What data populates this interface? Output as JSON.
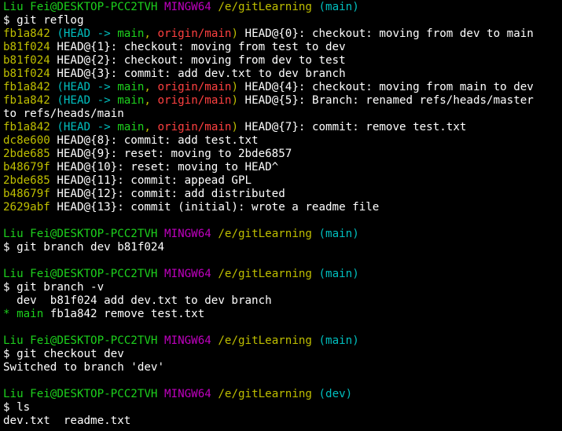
{
  "colors": {
    "default": "#ffffff",
    "green": "#1dd11d",
    "yellow": "#bfbf00",
    "magenta": "#bf00bf",
    "cyan": "#00bfbf",
    "red": "#ff4040",
    "bright_cyan": "#00d2d2"
  },
  "lines": [
    [
      {
        "t": "Liu Fei@DESKTOP-PCC2TVH",
        "c": "green"
      },
      {
        "t": " "
      },
      {
        "t": "MINGW64",
        "c": "magenta"
      },
      {
        "t": " "
      },
      {
        "t": "/e/gitLearning",
        "c": "yellow"
      },
      {
        "t": " "
      },
      {
        "t": "(main)",
        "c": "cyan"
      }
    ],
    [
      {
        "t": "$ git reflog"
      }
    ],
    [
      {
        "t": "fb1a842",
        "c": "yellow"
      },
      {
        "t": " "
      },
      {
        "t": "(HEAD -> ",
        "c": "cyan"
      },
      {
        "t": "main",
        "c": "green"
      },
      {
        "t": ", ",
        "c": "yellow"
      },
      {
        "t": "origin/main",
        "c": "red"
      },
      {
        "t": ")",
        "c": "yellow"
      },
      {
        "t": " HEAD@{0}: checkout: moving from dev to main"
      }
    ],
    [
      {
        "t": "b81f024",
        "c": "yellow"
      },
      {
        "t": " HEAD@{1}: checkout: moving from test to dev"
      }
    ],
    [
      {
        "t": "b81f024",
        "c": "yellow"
      },
      {
        "t": " HEAD@{2}: checkout: moving from dev to test"
      }
    ],
    [
      {
        "t": "b81f024",
        "c": "yellow"
      },
      {
        "t": " HEAD@{3}: commit: add dev.txt to dev branch"
      }
    ],
    [
      {
        "t": "fb1a842",
        "c": "yellow"
      },
      {
        "t": " "
      },
      {
        "t": "(HEAD -> ",
        "c": "cyan"
      },
      {
        "t": "main",
        "c": "green"
      },
      {
        "t": ", ",
        "c": "yellow"
      },
      {
        "t": "origin/main",
        "c": "red"
      },
      {
        "t": ")",
        "c": "yellow"
      },
      {
        "t": " HEAD@{4}: checkout: moving from main to dev"
      }
    ],
    [
      {
        "t": "fb1a842",
        "c": "yellow"
      },
      {
        "t": " "
      },
      {
        "t": "(HEAD -> ",
        "c": "cyan"
      },
      {
        "t": "main",
        "c": "green"
      },
      {
        "t": ", ",
        "c": "yellow"
      },
      {
        "t": "origin/main",
        "c": "red"
      },
      {
        "t": ")",
        "c": "yellow"
      },
      {
        "t": " HEAD@{5}: Branch: renamed refs/heads/master"
      }
    ],
    [
      {
        "t": "to refs/heads/main"
      }
    ],
    [
      {
        "t": "fb1a842",
        "c": "yellow"
      },
      {
        "t": " "
      },
      {
        "t": "(HEAD -> ",
        "c": "cyan"
      },
      {
        "t": "main",
        "c": "green"
      },
      {
        "t": ", ",
        "c": "yellow"
      },
      {
        "t": "origin/main",
        "c": "red"
      },
      {
        "t": ")",
        "c": "yellow"
      },
      {
        "t": " HEAD@{7}: commit: remove test.txt"
      }
    ],
    [
      {
        "t": "dc8e600",
        "c": "yellow"
      },
      {
        "t": " HEAD@{8}: commit: add test.txt"
      }
    ],
    [
      {
        "t": "2bde685",
        "c": "yellow"
      },
      {
        "t": " HEAD@{9}: reset: moving to 2bde6857"
      }
    ],
    [
      {
        "t": "b48679f",
        "c": "yellow"
      },
      {
        "t": " HEAD@{10}: reset: moving to HEAD^"
      }
    ],
    [
      {
        "t": "2bde685",
        "c": "yellow"
      },
      {
        "t": " HEAD@{11}: commit: appead GPL"
      }
    ],
    [
      {
        "t": "b48679f",
        "c": "yellow"
      },
      {
        "t": " HEAD@{12}: commit: add distributed"
      }
    ],
    [
      {
        "t": "2629abf",
        "c": "yellow"
      },
      {
        "t": " HEAD@{13}: commit (initial): wrote a readme file"
      }
    ],
    [],
    [
      {
        "t": "Liu Fei@DESKTOP-PCC2TVH",
        "c": "green"
      },
      {
        "t": " "
      },
      {
        "t": "MINGW64",
        "c": "magenta"
      },
      {
        "t": " "
      },
      {
        "t": "/e/gitLearning",
        "c": "yellow"
      },
      {
        "t": " "
      },
      {
        "t": "(main)",
        "c": "cyan"
      }
    ],
    [
      {
        "t": "$ git branch dev b81f024"
      }
    ],
    [],
    [
      {
        "t": "Liu Fei@DESKTOP-PCC2TVH",
        "c": "green"
      },
      {
        "t": " "
      },
      {
        "t": "MINGW64",
        "c": "magenta"
      },
      {
        "t": " "
      },
      {
        "t": "/e/gitLearning",
        "c": "yellow"
      },
      {
        "t": " "
      },
      {
        "t": "(main)",
        "c": "cyan"
      }
    ],
    [
      {
        "t": "$ git branch -v"
      }
    ],
    [
      {
        "t": "  dev  b81f024 add dev.txt to dev branch"
      }
    ],
    [
      {
        "t": "* ",
        "c": "green"
      },
      {
        "t": "main",
        "c": "green"
      },
      {
        "t": " fb1a842 remove test.txt"
      }
    ],
    [],
    [
      {
        "t": "Liu Fei@DESKTOP-PCC2TVH",
        "c": "green"
      },
      {
        "t": " "
      },
      {
        "t": "MINGW64",
        "c": "magenta"
      },
      {
        "t": " "
      },
      {
        "t": "/e/gitLearning",
        "c": "yellow"
      },
      {
        "t": " "
      },
      {
        "t": "(main)",
        "c": "cyan"
      }
    ],
    [
      {
        "t": "$ git checkout dev"
      }
    ],
    [
      {
        "t": "Switched to branch 'dev'"
      }
    ],
    [],
    [
      {
        "t": "Liu Fei@DESKTOP-PCC2TVH",
        "c": "green"
      },
      {
        "t": " "
      },
      {
        "t": "MINGW64",
        "c": "magenta"
      },
      {
        "t": " "
      },
      {
        "t": "/e/gitLearning",
        "c": "yellow"
      },
      {
        "t": " "
      },
      {
        "t": "(dev)",
        "c": "cyan"
      }
    ],
    [
      {
        "t": "$ ls"
      }
    ],
    [
      {
        "t": "dev.txt  readme.txt"
      }
    ]
  ]
}
